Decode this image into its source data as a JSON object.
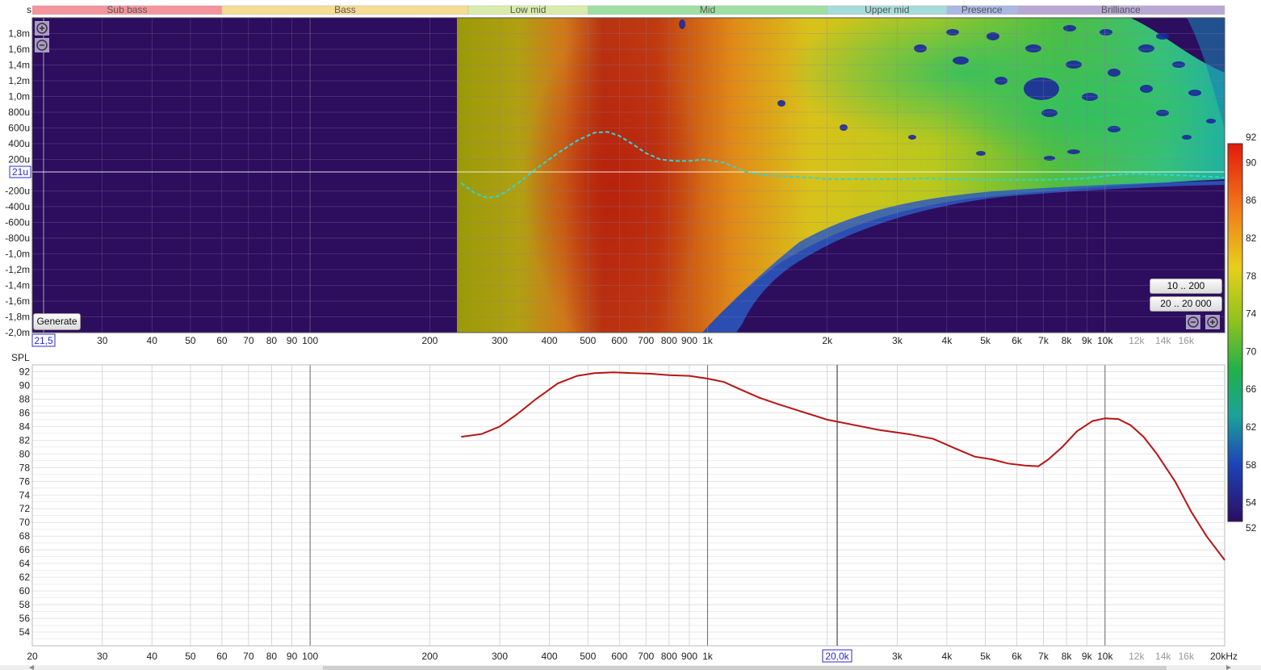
{
  "top_axis_unit": "s",
  "bands": [
    {
      "name": "Sub bass",
      "f0": 20,
      "f1": 60,
      "color": "#f4949c"
    },
    {
      "name": "Bass",
      "f0": 60,
      "f1": 250,
      "color": "#f7dc94"
    },
    {
      "name": "Low mid",
      "f0": 250,
      "f1": 500,
      "color": "#d9ecac"
    },
    {
      "name": "Mid",
      "f0": 500,
      "f1": 2000,
      "color": "#9ee0a4"
    },
    {
      "name": "Upper mid",
      "f0": 2000,
      "f1": 4000,
      "color": "#a6dcdc"
    },
    {
      "name": "Presence",
      "f0": 4000,
      "f1": 6000,
      "color": "#a9b8e4"
    },
    {
      "name": "Brilliance",
      "f0": 6000,
      "f1": 20000,
      "color": "#b9a8d6"
    }
  ],
  "chart_data": [
    {
      "type": "heatmap",
      "ylabel": "s",
      "x_scale": "log",
      "xlim": [
        20,
        20000
      ],
      "ylim": [
        -0.002,
        0.002
      ],
      "ytick_values": [
        0.0018,
        0.0016,
        0.0014,
        0.0012,
        0.001,
        0.0008,
        0.0006,
        0.0004,
        0.0002,
        -0.0002,
        -0.0004,
        -0.0006,
        -0.0008,
        -0.001,
        -0.0012,
        -0.0014,
        -0.0016,
        -0.0018,
        -0.002
      ],
      "ytick_labels": [
        "1,8m",
        "1,6m",
        "1,4m",
        "1,2m",
        "1,0m",
        "800u",
        "600u",
        "400u",
        "200u",
        "-200u",
        "-400u",
        "-600u",
        "-800u",
        "-1,0m",
        "-1,2m",
        "-1,4m",
        "-1,6m",
        "-1,8m",
        "-2,0m"
      ],
      "cursor_y_label": "21u",
      "cursor_x_label": "21,5",
      "colorbar": {
        "min": 52,
        "max": 92,
        "ticks": [
          92,
          90,
          86,
          82,
          78,
          74,
          70,
          66,
          62,
          58,
          54,
          52
        ]
      },
      "group_delay_series": {
        "x": [
          240,
          260,
          280,
          300,
          330,
          370,
          420,
          470,
          520,
          560,
          600,
          650,
          700,
          760,
          830,
          900,
          980,
          1100,
          1250,
          1400,
          1600,
          1800,
          2000,
          2500,
          3000,
          3500,
          4000,
          5000,
          6000,
          7000,
          8000,
          9000,
          10000,
          11000,
          12000,
          13000,
          15000,
          17000,
          20000
        ],
        "y": [
          -0.0001,
          -0.00023,
          -0.00029,
          -0.00026,
          -0.00012,
          8e-05,
          0.00028,
          0.00044,
          0.00054,
          0.00055,
          0.0005,
          0.00039,
          0.00028,
          0.0002,
          0.00018,
          0.00018,
          0.0002,
          0.00016,
          4e-05,
          0.0,
          -2e-05,
          -3e-05,
          -5e-05,
          -5e-05,
          -5e-05,
          -4e-05,
          -5e-05,
          -6e-05,
          -6e-05,
          -6e-05,
          -5e-05,
          -4e-05,
          -1e-05,
          1e-05,
          2e-05,
          1e-05,
          0.0,
          -1e-05,
          -3e-05
        ]
      },
      "buttons": {
        "generate": "Generate",
        "range_low": "10 .. 200",
        "range_full": "20 .. 20 000"
      }
    },
    {
      "type": "line",
      "ylabel": "SPL",
      "x_scale": "log",
      "xlim": [
        20,
        20000
      ],
      "ylim": [
        52,
        93
      ],
      "ytick_values": [
        92,
        90,
        88,
        86,
        84,
        82,
        80,
        78,
        76,
        74,
        72,
        70,
        68,
        66,
        64,
        62,
        60,
        58,
        56,
        54
      ],
      "cursor_x_label": "20,0k",
      "series": [
        {
          "color": "#b81414",
          "x": [
            240,
            270,
            300,
            330,
            370,
            420,
            470,
            520,
            580,
            650,
            720,
            800,
            900,
            1000,
            1100,
            1200,
            1350,
            1500,
            1700,
            2000,
            2300,
            2700,
            3200,
            3700,
            4200,
            4700,
            5200,
            5700,
            6300,
            6800,
            7200,
            7800,
            8500,
            9300,
            10000,
            10800,
            11600,
            12500,
            13500,
            15000,
            16500,
            18000,
            20000
          ],
          "y": [
            82.5,
            82.9,
            84,
            85.7,
            88,
            90.3,
            91.4,
            91.8,
            91.9,
            91.8,
            91.7,
            91.5,
            91.4,
            91,
            90.5,
            89.5,
            88.2,
            87.3,
            86.3,
            85,
            84.3,
            83.5,
            82.9,
            82.2,
            80.8,
            79.6,
            79.2,
            78.6,
            78.3,
            78.2,
            79.2,
            81,
            83.3,
            84.8,
            85.2,
            85.1,
            84.2,
            82.5,
            80,
            76,
            71.5,
            68,
            64.5
          ]
        }
      ]
    }
  ],
  "x_ticks": [
    {
      "f": 30,
      "label": "30"
    },
    {
      "f": 40,
      "label": "40"
    },
    {
      "f": 50,
      "label": "50"
    },
    {
      "f": 60,
      "label": "60"
    },
    {
      "f": 70,
      "label": "70"
    },
    {
      "f": 80,
      "label": "80"
    },
    {
      "f": 90,
      "label": "90"
    },
    {
      "f": 100,
      "label": "100"
    },
    {
      "f": 200,
      "label": "200"
    },
    {
      "f": 300,
      "label": "300"
    },
    {
      "f": 400,
      "label": "400"
    },
    {
      "f": 500,
      "label": "500"
    },
    {
      "f": 600,
      "label": "600"
    },
    {
      "f": 700,
      "label": "700"
    },
    {
      "f": 800,
      "label": "800"
    },
    {
      "f": 900,
      "label": "900"
    },
    {
      "f": 1000,
      "label": "1k"
    },
    {
      "f": 2000,
      "label": "2k"
    },
    {
      "f": 3000,
      "label": "3k"
    },
    {
      "f": 4000,
      "label": "4k"
    },
    {
      "f": 5000,
      "label": "5k"
    },
    {
      "f": 6000,
      "label": "6k"
    },
    {
      "f": 7000,
      "label": "7k"
    },
    {
      "f": 8000,
      "label": "8k"
    },
    {
      "f": 9000,
      "label": "9k"
    },
    {
      "f": 10000,
      "label": "10k"
    },
    {
      "f": 12000,
      "label": "12k"
    },
    {
      "f": 14000,
      "label": "14k"
    },
    {
      "f": 16000,
      "label": "16k"
    }
  ],
  "bottom_x_first_label": "20",
  "bottom_x_last_label": "20kHz"
}
